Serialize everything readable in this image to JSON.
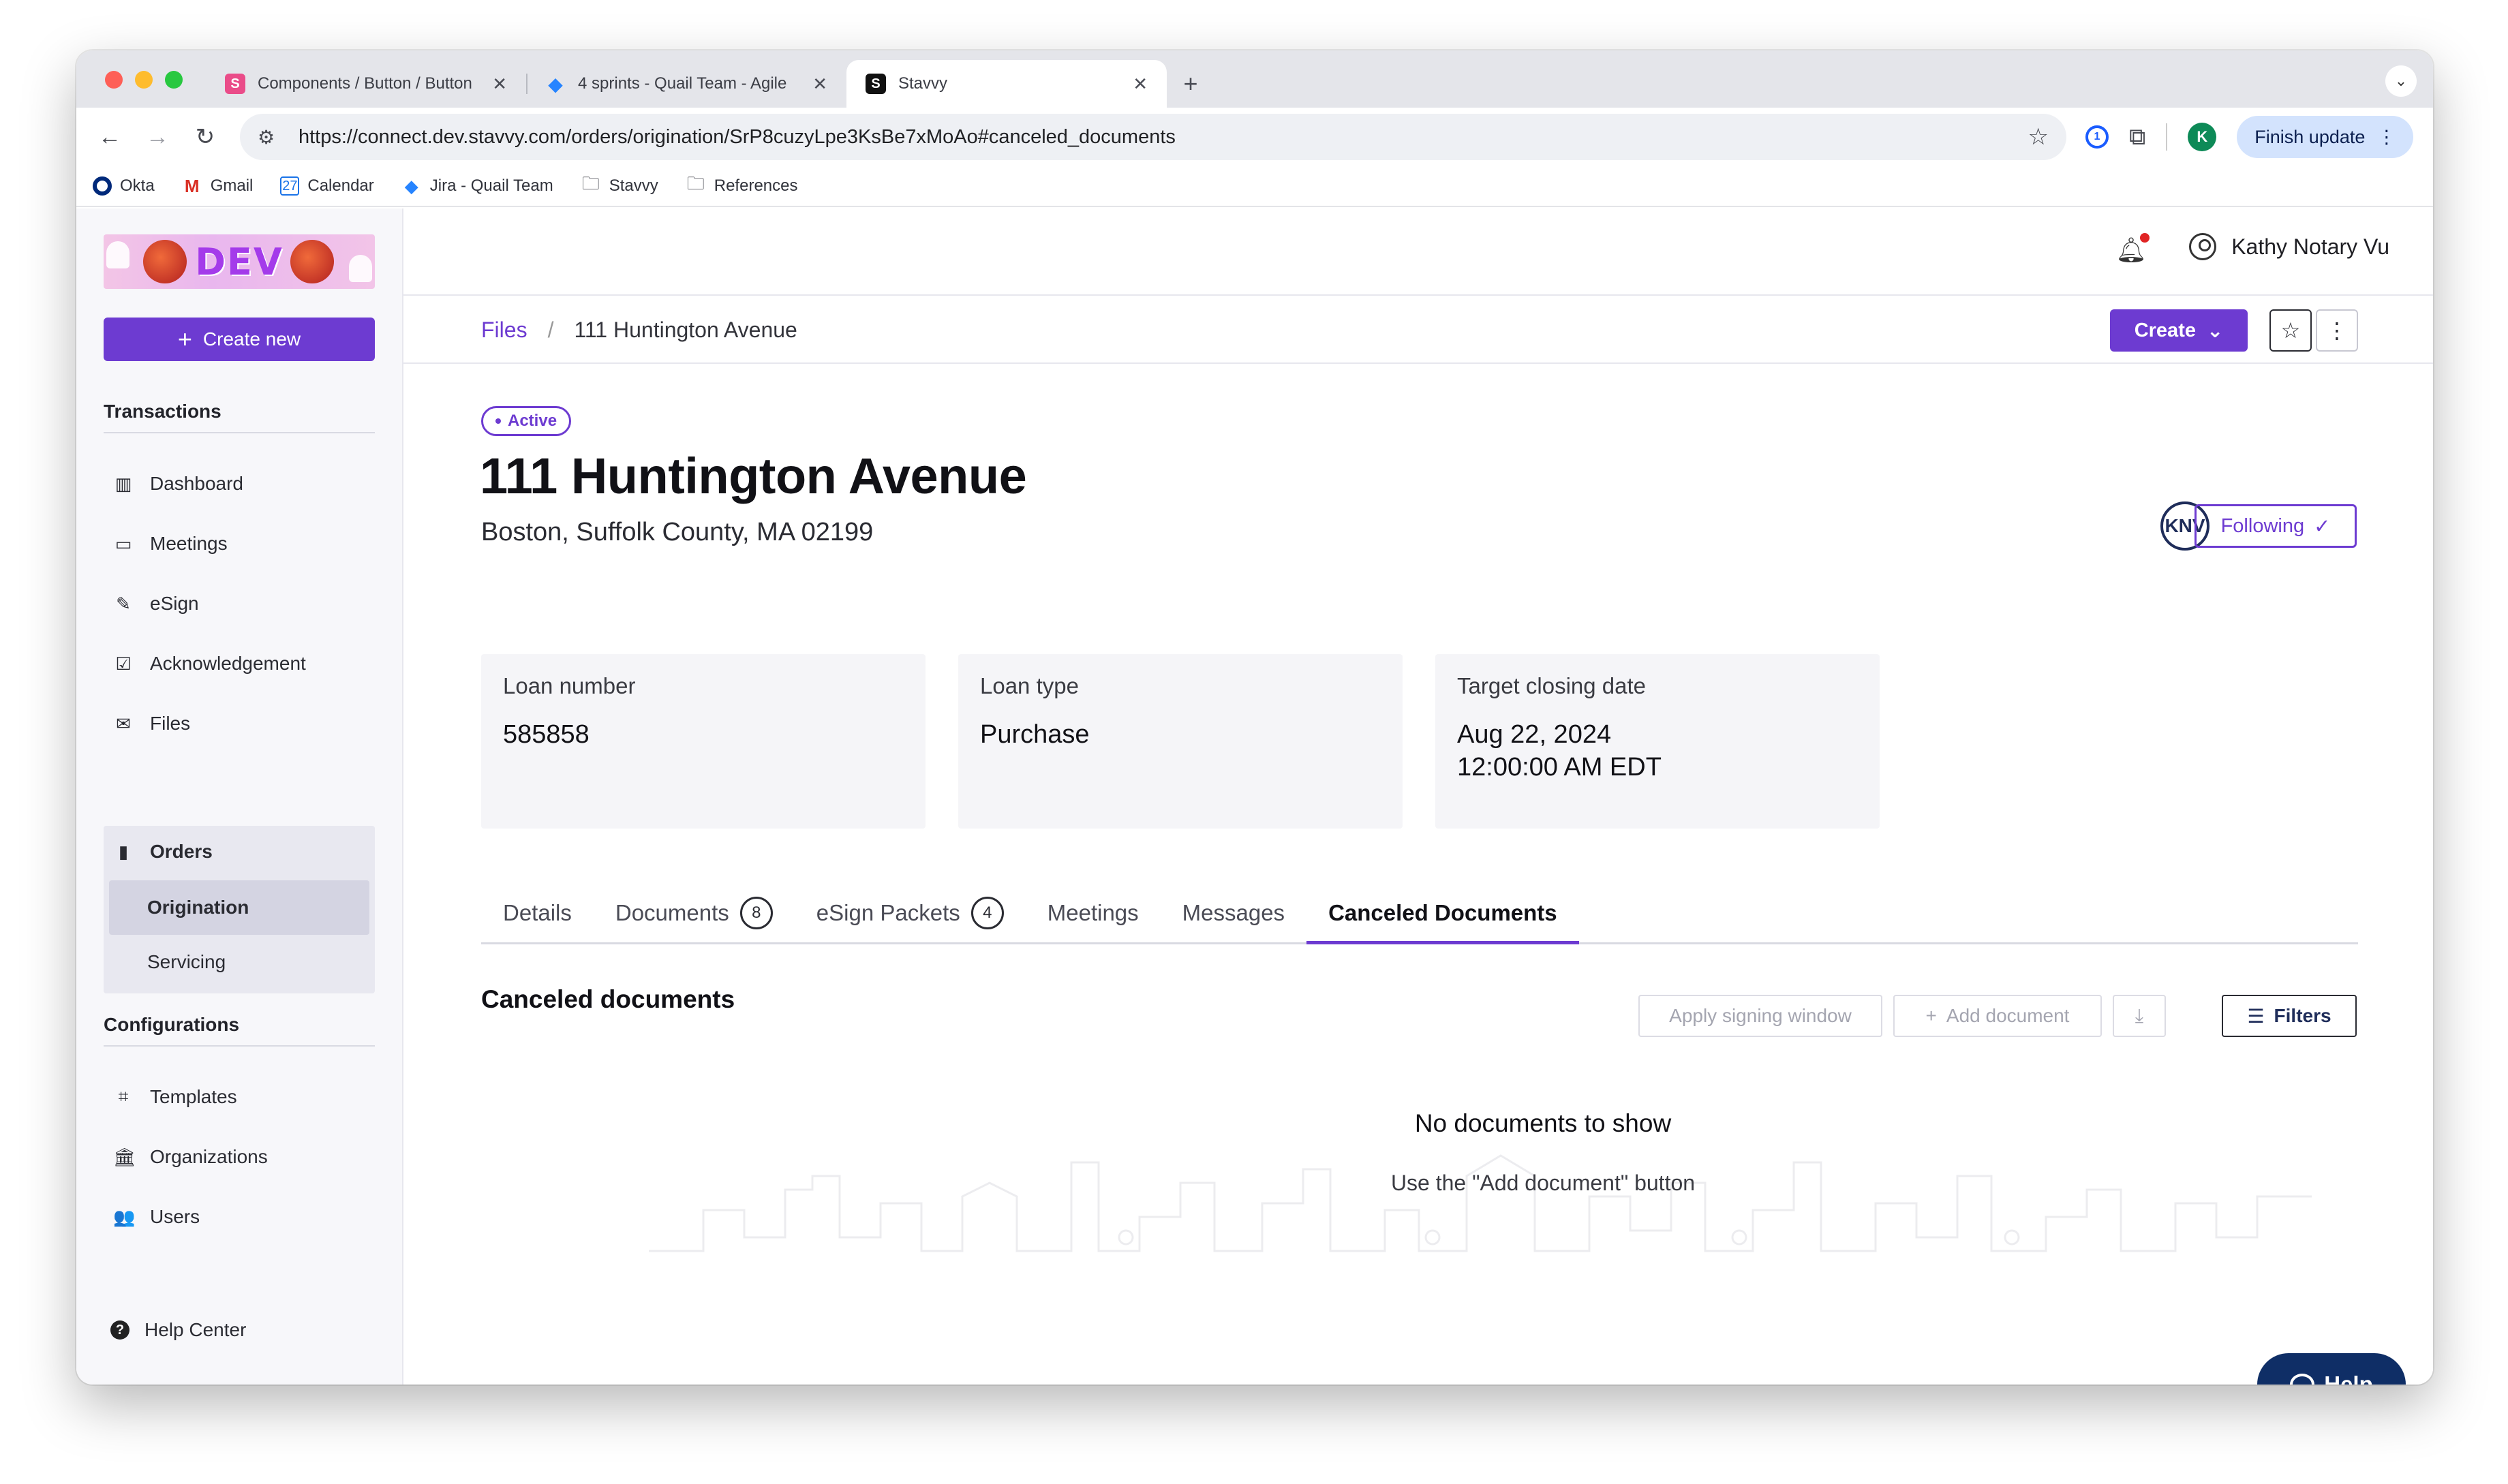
{
  "browser": {
    "tabs": [
      {
        "label": "Components / Button / Button",
        "favicon": "figma-s-icon"
      },
      {
        "label": "4 sprints - Quail Team - Agile",
        "favicon": "jira-icon"
      },
      {
        "label": "Stavvy",
        "favicon": "stavvy-icon",
        "active": true
      }
    ],
    "url": "https://connect.dev.stavvy.com/orders/origination/SrP8cuzyLpe3KsBe7xMoAo#canceled_documents",
    "profile_initial": "K",
    "finish_update_label": "Finish update",
    "bookmarks": [
      "Okta",
      "Gmail",
      "Calendar",
      "Jira - Quail Team",
      "Stavvy",
      "References"
    ]
  },
  "sidebar": {
    "logo_text": "DEV",
    "create_new_label": "Create new",
    "transactions_title": "Transactions",
    "transactions_items": [
      "Dashboard",
      "Meetings",
      "eSign",
      "Acknowledgement",
      "Files"
    ],
    "orders": {
      "label": "Orders",
      "children": [
        "Origination",
        "Servicing"
      ],
      "active_child": "Origination"
    },
    "configurations_title": "Configurations",
    "configurations_items": [
      "Templates",
      "Organizations",
      "Users"
    ],
    "help_center_label": "Help Center"
  },
  "header": {
    "user_name": "Kathy Notary Vu"
  },
  "breadcrumb": {
    "root": "Files",
    "separator": "/",
    "current": "111 Huntington Avenue"
  },
  "actions": {
    "create_label": "Create"
  },
  "order": {
    "status": "Active",
    "title": "111 Huntington Avenue",
    "address": "Boston, Suffolk County, MA 02199",
    "avatar_initials": "KNV",
    "following_label": "Following",
    "cards": [
      {
        "label": "Loan number",
        "value": "585858"
      },
      {
        "label": "Loan type",
        "value": "Purchase"
      },
      {
        "label": "Target closing date",
        "value": "Aug 22, 2024",
        "value2": "12:00:00 AM EDT"
      }
    ]
  },
  "tabs": [
    {
      "label": "Details"
    },
    {
      "label": "Documents",
      "count": "8"
    },
    {
      "label": "eSign Packets",
      "count": "4"
    },
    {
      "label": "Meetings"
    },
    {
      "label": "Messages"
    },
    {
      "label": "Canceled Documents",
      "active": true
    }
  ],
  "canceled": {
    "heading": "Canceled documents",
    "apply_label": "Apply signing window",
    "add_label": "Add document",
    "filters_label": "Filters",
    "empty_title": "No documents to show",
    "empty_sub": "Use the \"Add document\" button"
  },
  "help_fab_label": "Help",
  "colors": {
    "brand_purple": "#6d3bd1",
    "navy": "#0f2e66"
  }
}
